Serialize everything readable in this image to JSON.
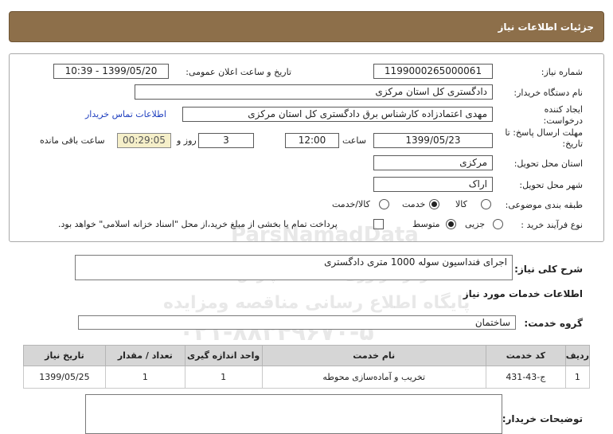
{
  "page": {
    "title": "جزئیات اطلاعات نیاز"
  },
  "form": {
    "need_number_label": "شماره نیاز:",
    "need_number": "1199000265000061",
    "announce_label": "تاریخ و ساعت اعلان عمومی:",
    "announce_value": "1399/05/20 - 10:39",
    "buyer_org_label": "نام دستگاه خریدار:",
    "buyer_org": "دادگستری کل استان مرکزی",
    "requester_label": "ایجاد کننده درخواست:",
    "requester": "مهدی اعتمادزاده کارشناس برق دادگستری کل استان مرکزی",
    "contact_link": "اطلاعات تماس خریدار",
    "deadline_label": "مهلت ارسال پاسخ: تا تاریخ:",
    "deadline_date": "1399/05/23",
    "time_label": "ساعت",
    "deadline_time": "12:00",
    "days_value": "3",
    "days_label": "روز و",
    "remaining_time": "00:29:05",
    "remaining_label": "ساعت باقی مانده",
    "province_label": "استان محل تحویل:",
    "province": "مرکزی",
    "city_label": "شهر محل تحویل:",
    "city": "اراک",
    "category_label": "طبقه بندی موضوعی:",
    "category_options": [
      "کالا",
      "خدمت",
      "کالا/خدمت"
    ],
    "category_selected_index": 1,
    "process_label": "نوع فرآیند خرید :",
    "process_options": [
      "جزیی",
      "متوسط"
    ],
    "process_selected_index": 1,
    "treasury_note": "پرداخت تمام یا بخشی از مبلغ خرید،از محل \"اسناد خزانه اسلامی\" خواهد بود.",
    "treasury_checked": false
  },
  "description": {
    "label": "شرح کلی نیاز:",
    "value": "اجرای فنداسیون سوله 1000 متری دادگستری"
  },
  "services_section": {
    "title": "اطلاعات خدمات مورد نیاز",
    "group_label": "گروه خدمت:",
    "group_value": "ساختمان",
    "columns": [
      "ردیف",
      "کد خدمت",
      "نام خدمت",
      "واحد اندازه گیری",
      "تعداد / مقدار",
      "تاریخ نیاز"
    ],
    "rows": [
      [
        "1",
        "ج-43-431",
        "تخریب و آماده‌سازی محوطه",
        "1",
        "1",
        "1399/05/25"
      ]
    ]
  },
  "buyer_notes": {
    "label": "توضیحات خریدار:",
    "value": ""
  },
  "watermark": {
    "line1": "ParsNamadData",
    "line2": "مرکز فراوری اطلاعات پارس نماد داده",
    "line3": "پایگاه اطلاع رسانی مناقصه ومزایده",
    "line4": "۰۲۱-۸۸۳۴۹۶۷۰-۵"
  },
  "colors": {
    "header_bg": "#8d6f4a",
    "table_header_bg": "#d6d6d6",
    "timer_bg": "#f5efc9",
    "link": "#1f3fbf"
  }
}
